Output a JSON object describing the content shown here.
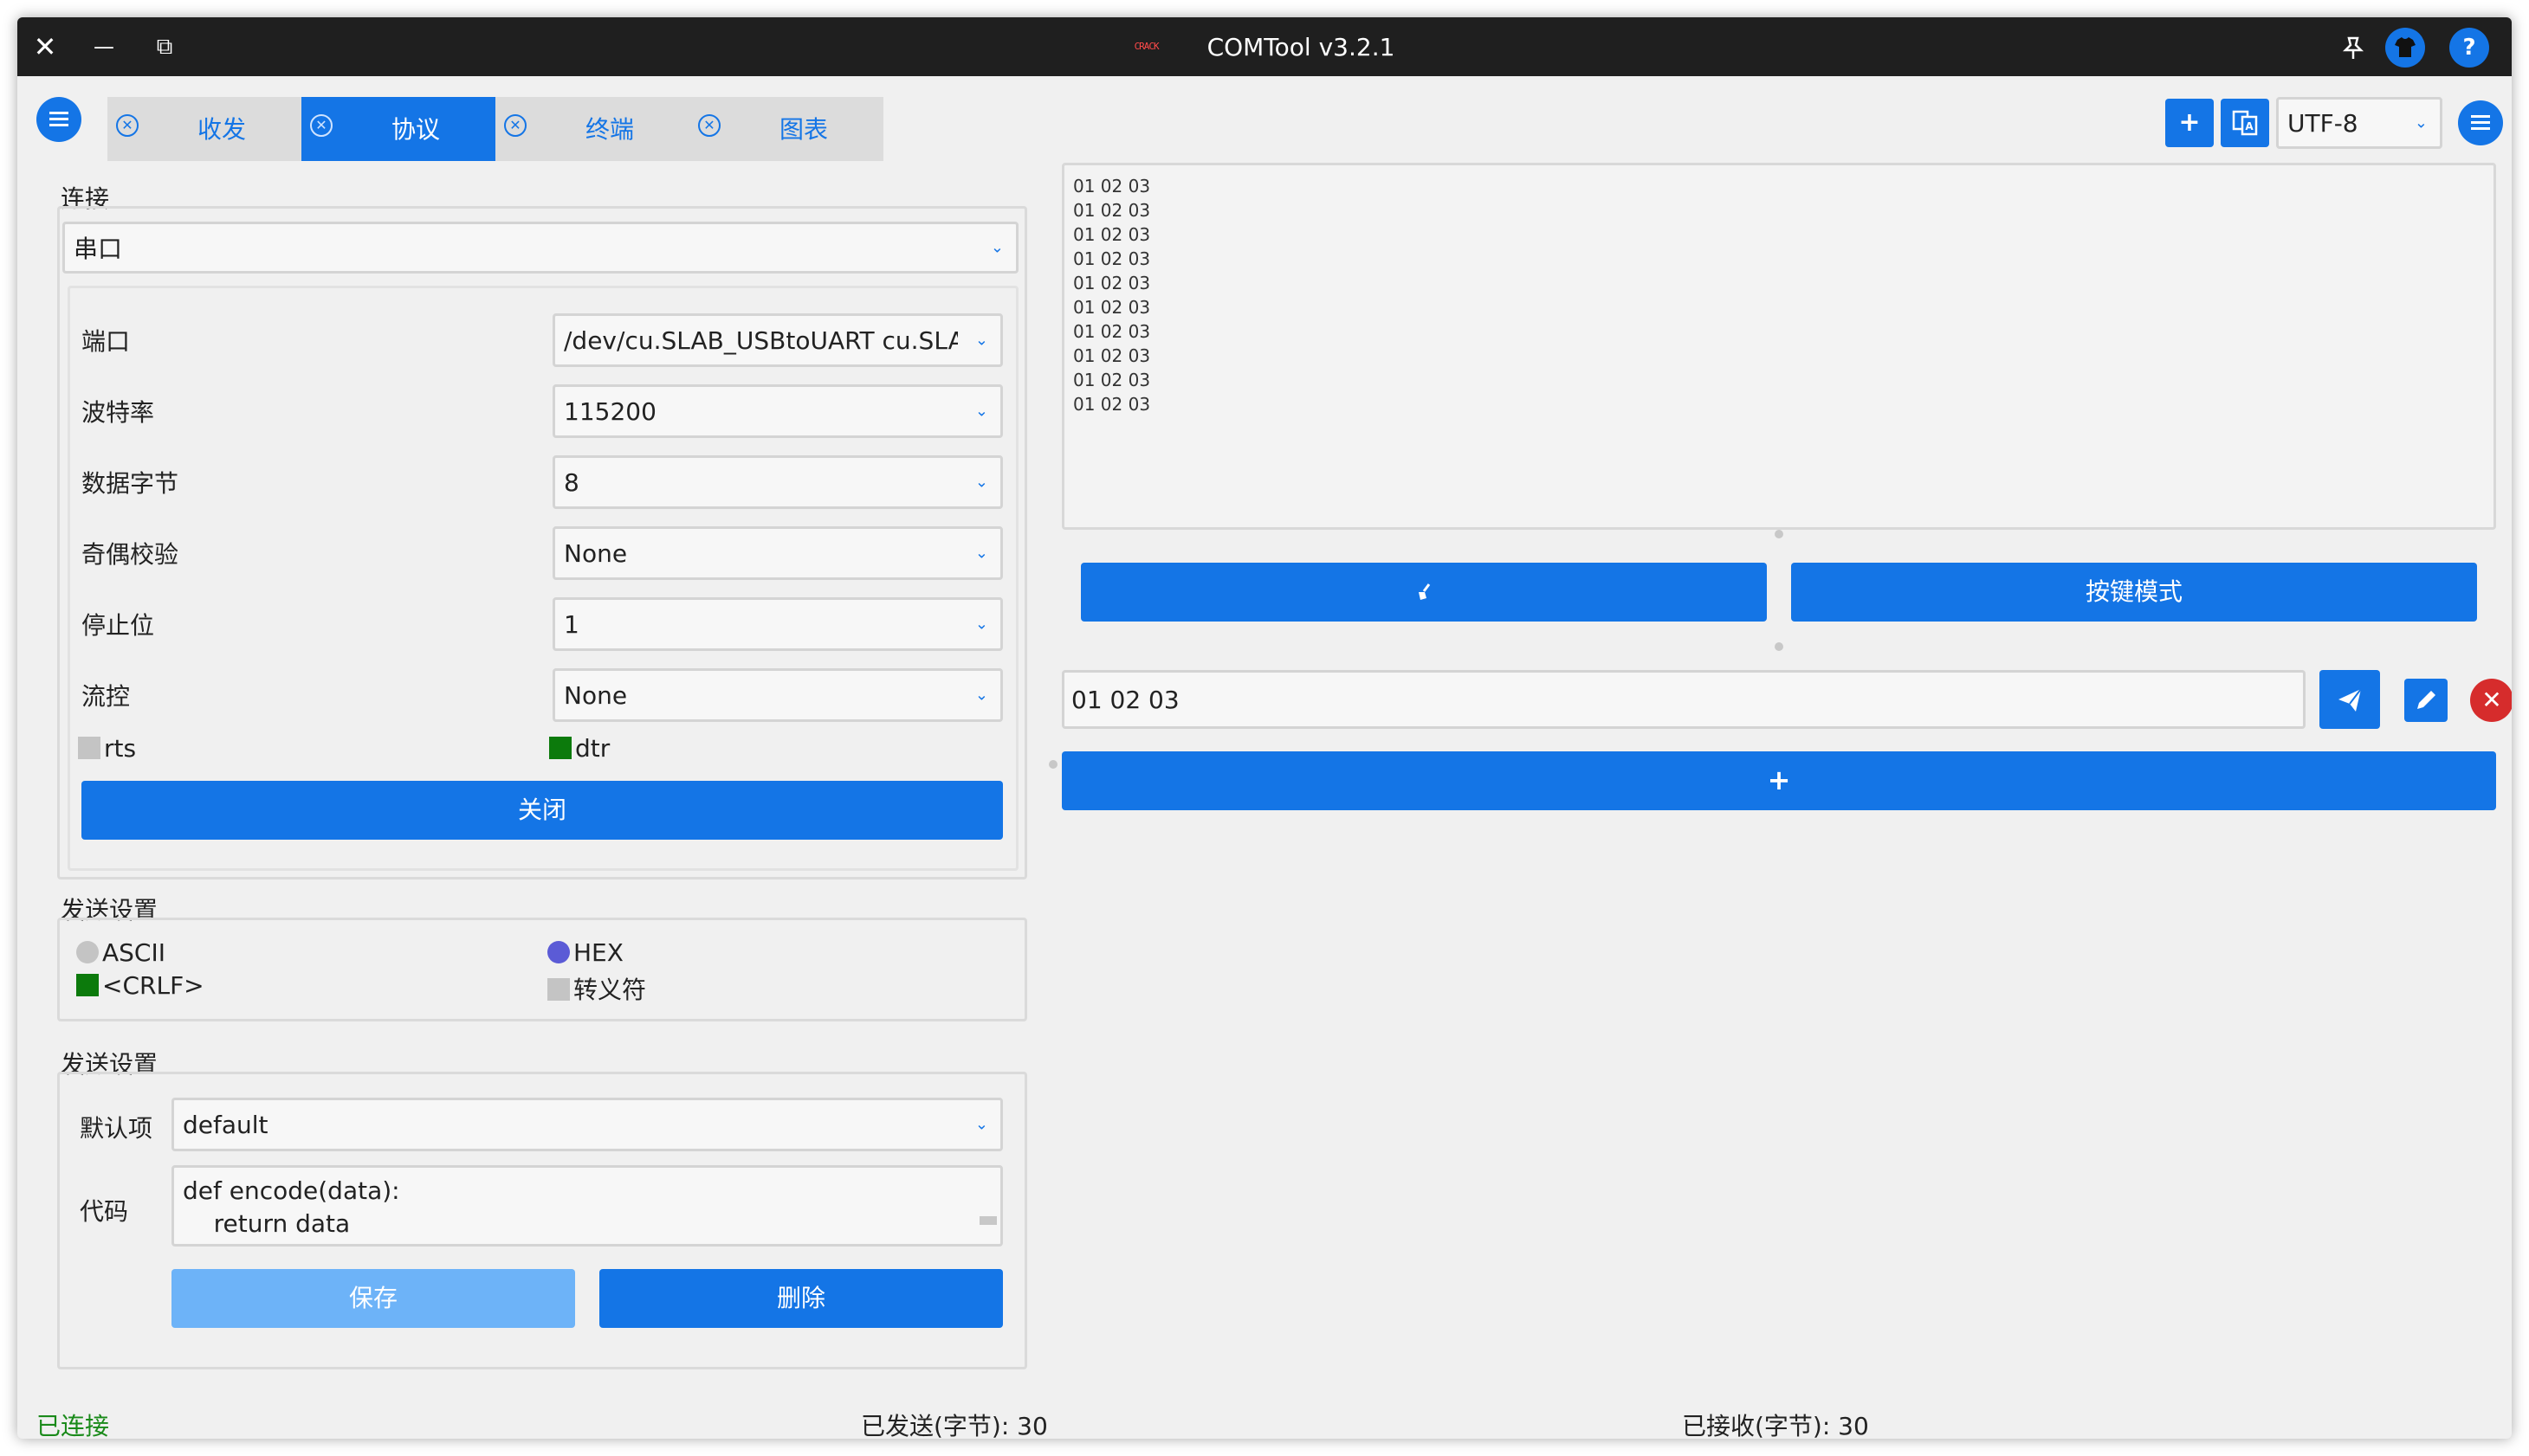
{
  "window": {
    "title": "COMTool v3.2.1",
    "logo_text": "CRACK"
  },
  "titlebar": {
    "close_glyph": "✕",
    "minimize_glyph": "—",
    "restore_glyph": "⧉",
    "pin_icon": "pin-icon",
    "skin_icon": "shirt-icon",
    "help_glyph": "?"
  },
  "tabs": [
    {
      "label": "收发"
    },
    {
      "label": "协议"
    },
    {
      "label": "终端"
    },
    {
      "label": "图表"
    }
  ],
  "toolbar": {
    "add_glyph": "+",
    "encoding": "UTF-8"
  },
  "connection": {
    "title": "连接",
    "type": "串口",
    "fields": [
      {
        "label": "端口",
        "value": "/dev/cu.SLAB_USBtoUART cu.SLAB_U"
      },
      {
        "label": "波特率",
        "value": "115200"
      },
      {
        "label": "数据字节",
        "value": "8"
      },
      {
        "label": "奇偶校验",
        "value": "None"
      },
      {
        "label": "停止位",
        "value": "1"
      },
      {
        "label": "流控",
        "value": "None"
      }
    ],
    "rts_label": "rts",
    "dtr_label": "dtr",
    "close_button": "关闭"
  },
  "send_settings": {
    "title": "发送设置",
    "ascii_label": "ASCII",
    "hex_label": "HEX",
    "crlf_label": "<CRLF>",
    "escape_label": "转义符"
  },
  "protocol_settings": {
    "title": "发送设置",
    "default_label": "默认项",
    "default_value": "default",
    "code_label": "代码",
    "code_line1": "def encode(data):",
    "code_line2": "    return data",
    "save_button": "保存",
    "delete_button": "删除"
  },
  "receive": {
    "lines": [
      "01 02 03",
      "01 02 03",
      "01 02 03",
      "01 02 03",
      "01 02 03",
      "01 02 03",
      "01 02 03",
      "01 02 03",
      "01 02 03",
      "01 02 03"
    ]
  },
  "actions": {
    "clear_glyph": "🖌",
    "key_mode_button": "按键模式",
    "send_value": "01 02 03",
    "add_glyph": "+"
  },
  "status": {
    "connected": "已连接",
    "sent": "已发送(字节): 30",
    "received": "已接收(字节): 30"
  },
  "colors": {
    "accent": "#1475e6",
    "connected": "#1a8a1a",
    "dtr_checked": "#0c7a0c",
    "hex_radio": "#5b5bd6"
  }
}
